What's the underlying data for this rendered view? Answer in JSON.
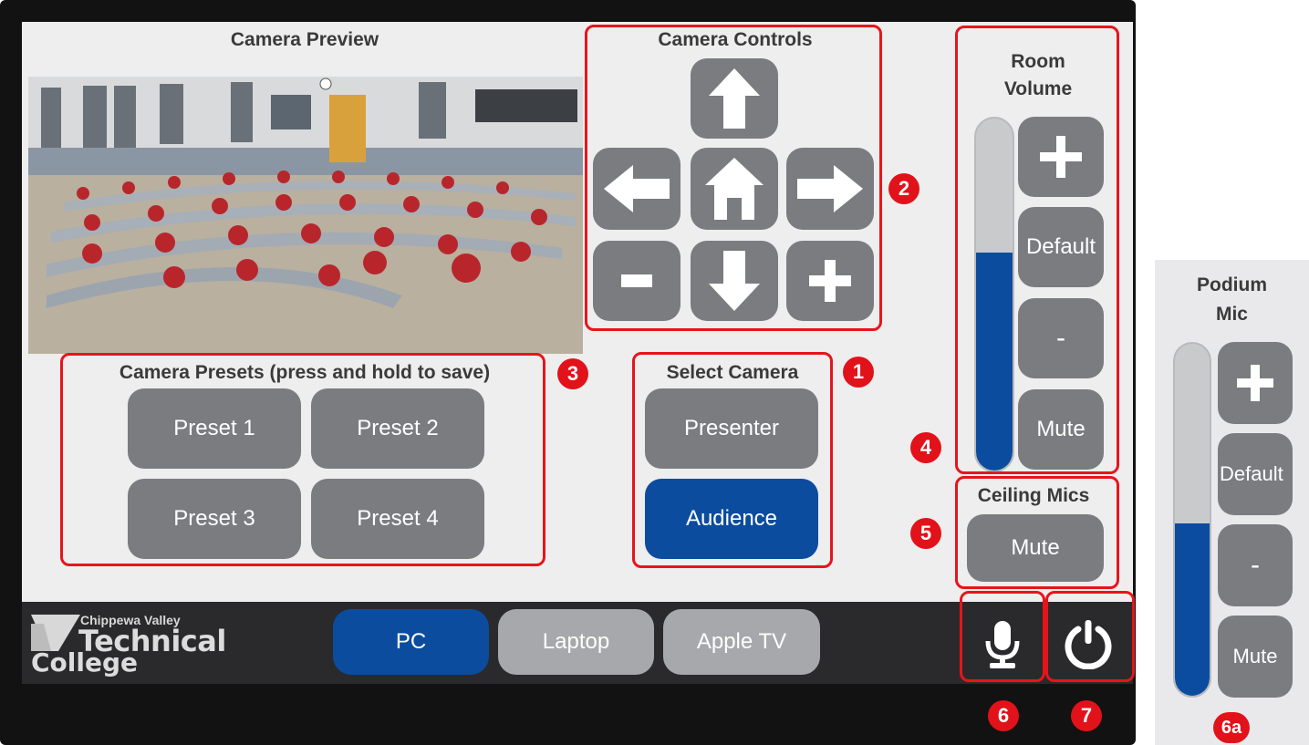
{
  "preview": {
    "title": "Camera Preview"
  },
  "camera_controls": {
    "title": "Camera Controls",
    "badge": "2"
  },
  "presets": {
    "title": "Camera Presets (press and hold to save)",
    "badge": "3",
    "items": [
      "Preset 1",
      "Preset 2",
      "Preset 3",
      "Preset 4"
    ]
  },
  "select_camera": {
    "title": "Select Camera",
    "badge": "1",
    "options": [
      "Presenter",
      "Audience"
    ],
    "selected": "Audience"
  },
  "room_volume": {
    "title_line1": "Room",
    "title_line2": "Volume",
    "plus": "+",
    "default_label": "Default",
    "minus": "-",
    "mute_label": "Mute",
    "level": 0.62,
    "badge": "4"
  },
  "ceiling_mics": {
    "title": "Ceiling Mics",
    "mute_label": "Mute",
    "badge": "5"
  },
  "sources": {
    "items": [
      "PC",
      "Laptop",
      "Apple TV"
    ],
    "selected": "PC"
  },
  "logo": {
    "line1": "Chippewa Valley",
    "line2": "Technical",
    "line3": "College"
  },
  "badges": {
    "mic": "6",
    "power": "7"
  },
  "podium_mic": {
    "title_line1": "Podium",
    "title_line2": "Mic",
    "plus": "+",
    "default_label": "Default",
    "minus": "-",
    "mute_label": "Mute",
    "level": 0.49,
    "badge": "6a"
  },
  "colors": {
    "accent": "#0b4c9e",
    "button": "#7b7c80",
    "annotation": "#e8141b"
  }
}
